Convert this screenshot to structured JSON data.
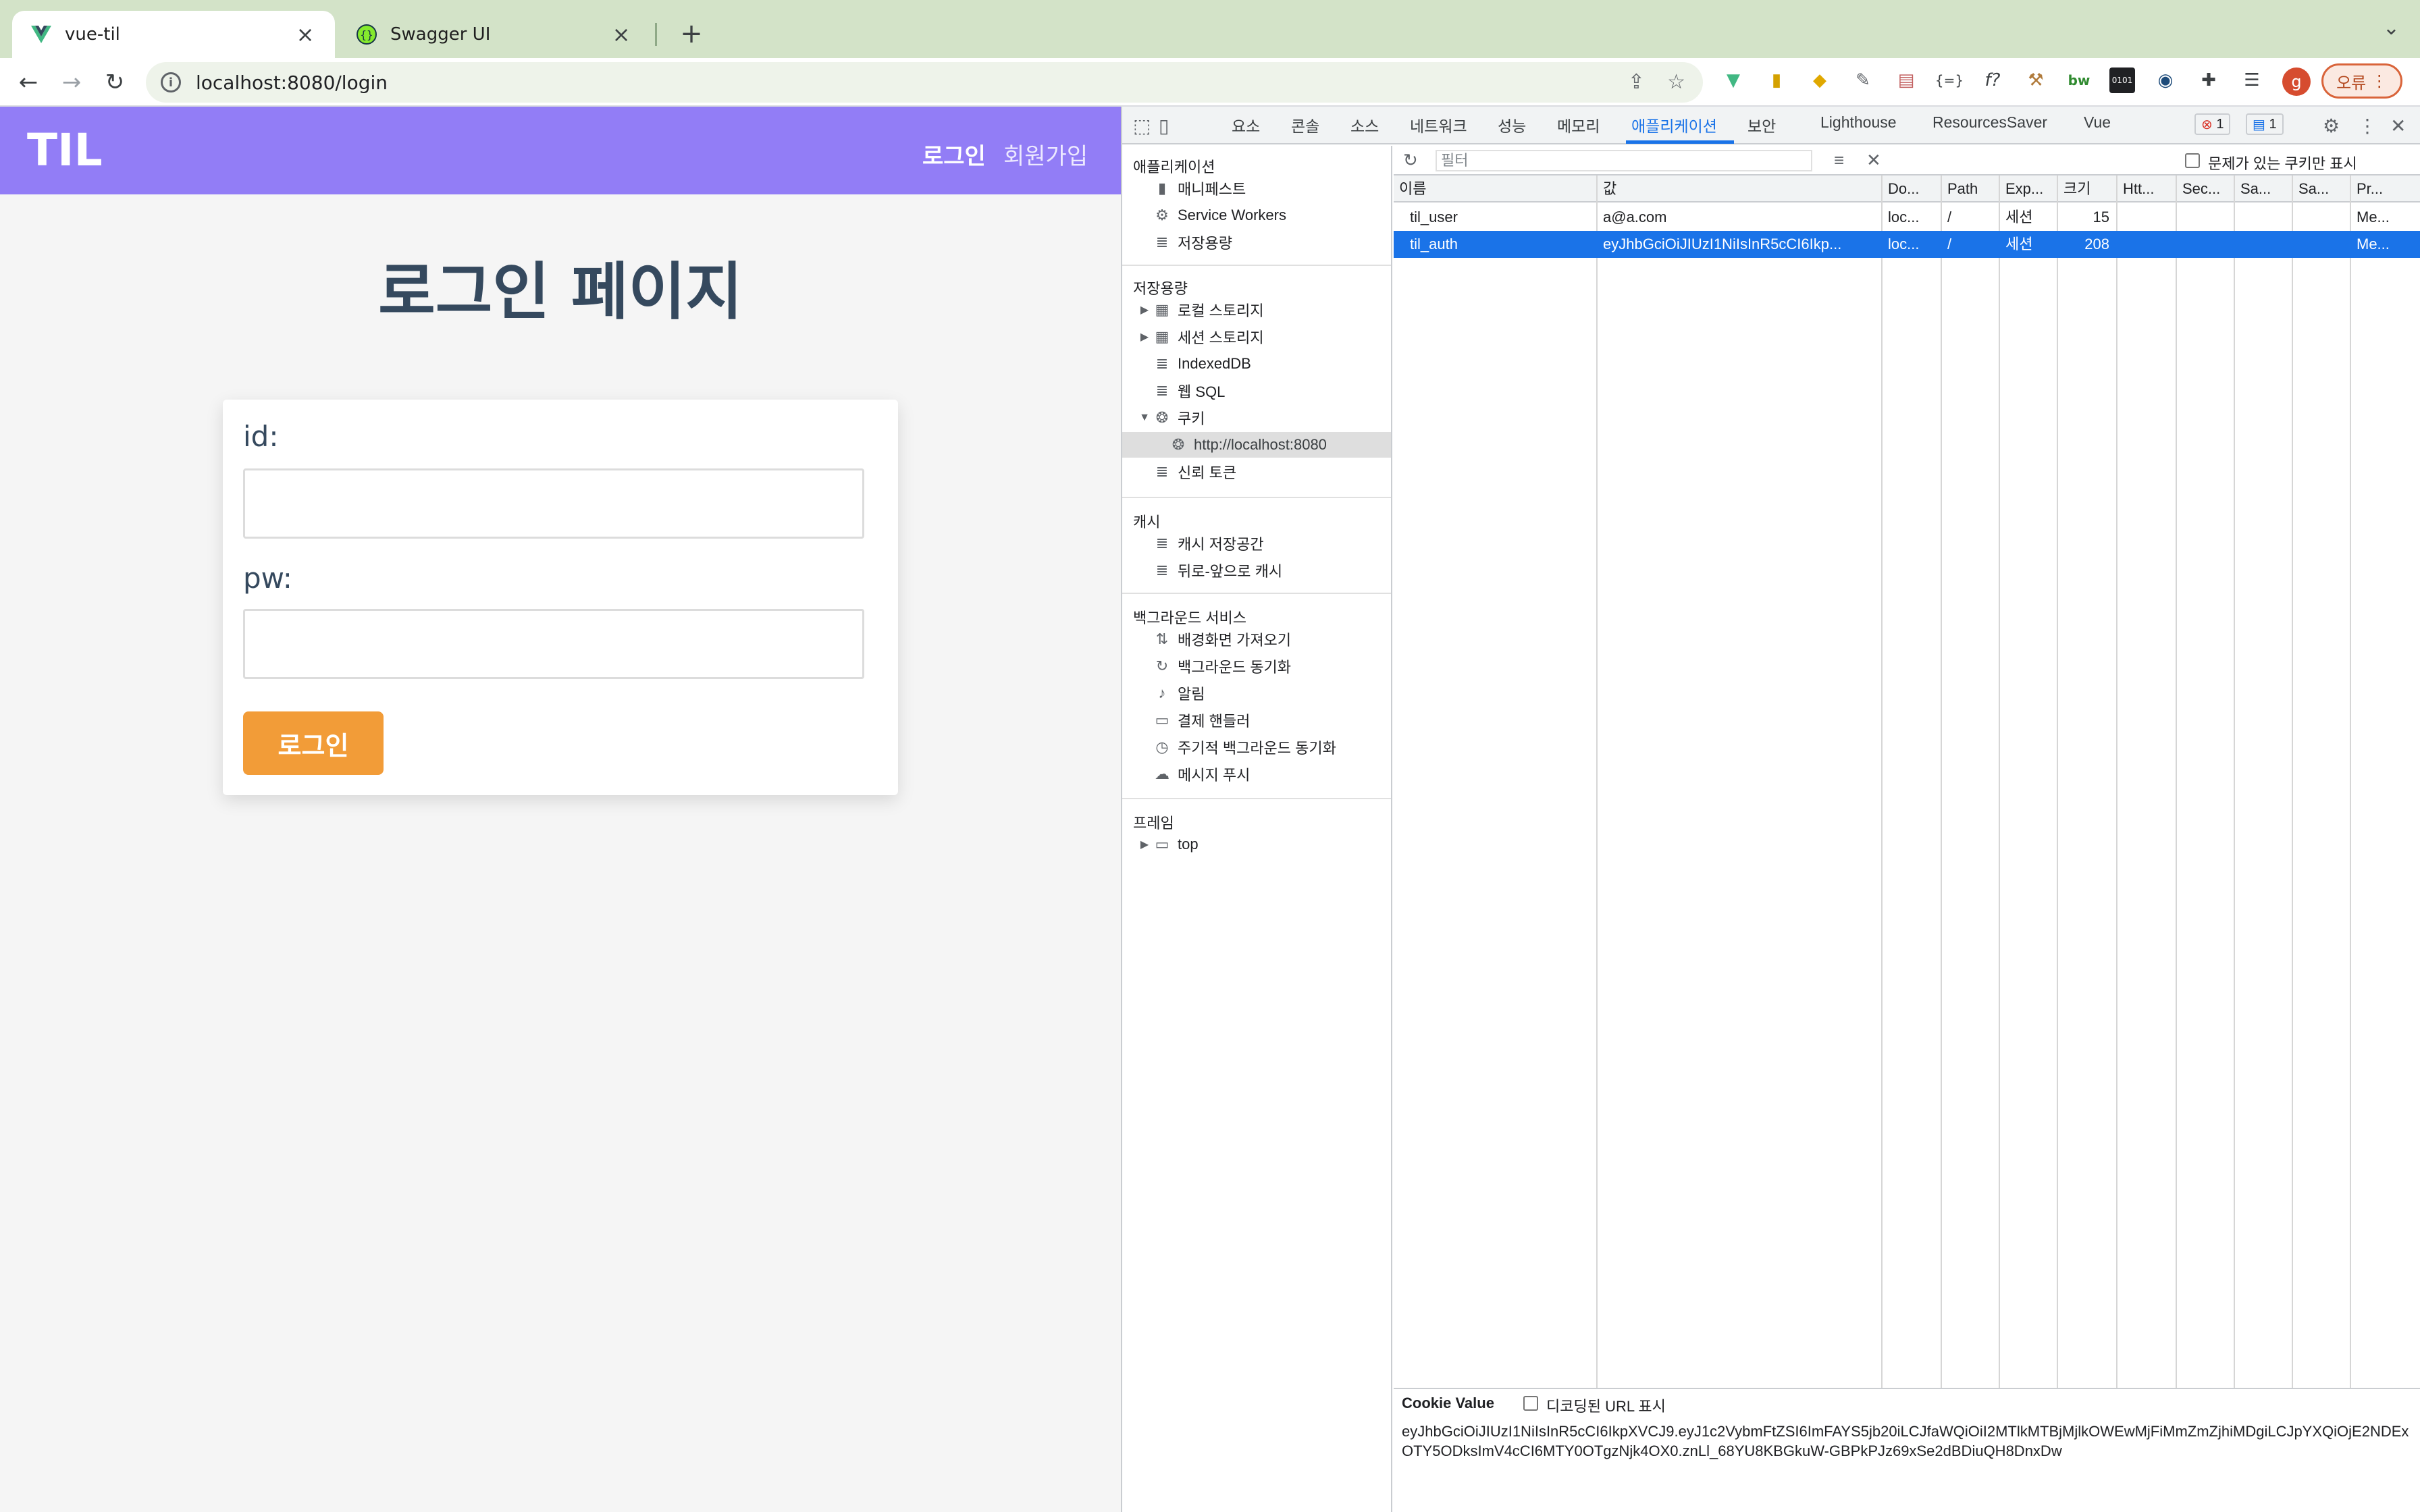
{
  "browser": {
    "tabs": [
      {
        "title": "vue-til",
        "active": true
      },
      {
        "title": "Swagger UI",
        "active": false
      }
    ],
    "url": "localhost:8080/login",
    "error_button": "오류",
    "profile_initial": "g"
  },
  "app": {
    "logo": "TIL",
    "nav": {
      "login": "로그인",
      "signup": "회원가입"
    },
    "title": "로그인 페이지",
    "form": {
      "id_label": "id:",
      "id_value": "",
      "pw_label": "pw:",
      "pw_value": "",
      "submit": "로그인"
    },
    "colors": {
      "header": "#927df6",
      "button": "#f29c38",
      "title": "#35495e"
    }
  },
  "devtools": {
    "tabs": [
      "요소",
      "콘솔",
      "소스",
      "네트워크",
      "성능",
      "메모리",
      "애플리케이션",
      "보안",
      "Lighthouse",
      "ResourcesSaver",
      "Vue"
    ],
    "active_tab": "애플리케이션",
    "error_count": "1",
    "message_count": "1",
    "sidebar": {
      "app_section": "애플리케이션",
      "app_items": [
        "매니페스트",
        "Service Workers",
        "저장용량"
      ],
      "storage_section": "저장용량",
      "storage_items": [
        "로컬 스토리지",
        "세션 스토리지",
        "IndexedDB",
        "웹 SQL",
        "쿠키",
        "http://localhost:8080",
        "신뢰 토큰"
      ],
      "cache_section": "캐시",
      "cache_items": [
        "캐시 저장공간",
        "뒤로-앞으로 캐시"
      ],
      "bg_section": "백그라운드 서비스",
      "bg_items": [
        "배경화면 가져오기",
        "백그라운드 동기화",
        "알림",
        "결제 핸들러",
        "주기적 백그라운드 동기화",
        "메시지 푸시"
      ],
      "frame_section": "프레임",
      "frame_items": [
        "top"
      ]
    },
    "filter": {
      "placeholder": "필터",
      "only_issues_label": "문제가 있는 쿠키만 표시"
    },
    "cookies": {
      "columns": [
        "이름",
        "값",
        "Do...",
        "Path",
        "Exp...",
        "크기",
        "Htt...",
        "Sec...",
        "Sa...",
        "Sa...",
        "Pr..."
      ],
      "rows": [
        {
          "name": "til_user",
          "value": "a@a.com",
          "domain": "loc...",
          "path": "/",
          "expires": "세션",
          "size": "15",
          "http": "",
          "secure": "",
          "samesite": "",
          "sameparty": "",
          "priority": "Me..."
        },
        {
          "name": "til_auth",
          "value": "eyJhbGciOiJIUzI1NiIsInR5cCI6Ikp...",
          "domain": "loc...",
          "path": "/",
          "expires": "세션",
          "size": "208",
          "http": "",
          "secure": "",
          "samesite": "",
          "sameparty": "",
          "priority": "Me..."
        }
      ]
    },
    "cookie_value": {
      "title": "Cookie Value",
      "decoded_label": "디코딩된 URL 표시",
      "line1": "eyJhbGciOiJIUzI1NiIsInR5cCI6IkpXVCJ9.eyJ1c2VybmFtZSI6ImFAYS5jb20iLCJfaWQiOiI2MTlkMTBjMjlkOWEwMjFiMmZmZjhiMDgiLCJpYXQiOjE2NDExOTY5ODksImV4cCI6MTY0OTgzNjk4OX0.znLl_68YU8KBGkuW-GBPkPJz69xSe2dBDiuQH8DnxDw",
      "line2": ""
    }
  }
}
